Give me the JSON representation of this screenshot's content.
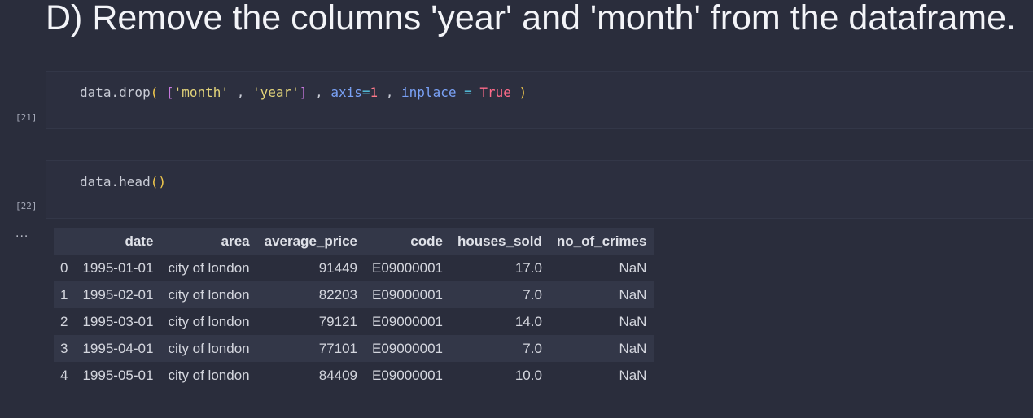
{
  "heading": "D) Remove the columns 'year' and 'month' from the dataframe.",
  "cells": [
    {
      "exec_count": "[21]",
      "code_tokens": [
        {
          "t": "data.drop",
          "c": "fn"
        },
        {
          "t": "(",
          "c": "paren"
        },
        {
          "t": " ",
          "c": "op"
        },
        {
          "t": "[",
          "c": "bracket"
        },
        {
          "t": "'month'",
          "c": "str"
        },
        {
          "t": " , ",
          "c": "op"
        },
        {
          "t": "'year'",
          "c": "str"
        },
        {
          "t": "]",
          "c": "bracket"
        },
        {
          "t": " , ",
          "c": "op"
        },
        {
          "t": "axis",
          "c": "kw"
        },
        {
          "t": "=",
          "c": "eq"
        },
        {
          "t": "1",
          "c": "num"
        },
        {
          "t": " , ",
          "c": "op"
        },
        {
          "t": "inplace",
          "c": "kw"
        },
        {
          "t": " = ",
          "c": "eq"
        },
        {
          "t": "True",
          "c": "bool"
        },
        {
          "t": " ",
          "c": "op"
        },
        {
          "t": ")",
          "c": "paren"
        }
      ]
    },
    {
      "exec_count": "[22]",
      "code_tokens": [
        {
          "t": "data.head",
          "c": "fn"
        },
        {
          "t": "()",
          "c": "paren"
        }
      ]
    }
  ],
  "output_prompt": "...",
  "dataframe": {
    "columns": [
      "",
      "date",
      "area",
      "average_price",
      "code",
      "houses_sold",
      "no_of_crimes"
    ],
    "rows": [
      [
        "0",
        "1995-01-01",
        "city of london",
        "91449",
        "E09000001",
        "17.0",
        "NaN"
      ],
      [
        "1",
        "1995-02-01",
        "city of london",
        "82203",
        "E09000001",
        "7.0",
        "NaN"
      ],
      [
        "2",
        "1995-03-01",
        "city of london",
        "79121",
        "E09000001",
        "14.0",
        "NaN"
      ],
      [
        "3",
        "1995-04-01",
        "city of london",
        "77101",
        "E09000001",
        "7.0",
        "NaN"
      ],
      [
        "4",
        "1995-05-01",
        "city of london",
        "84409",
        "E09000001",
        "10.0",
        "NaN"
      ]
    ]
  }
}
